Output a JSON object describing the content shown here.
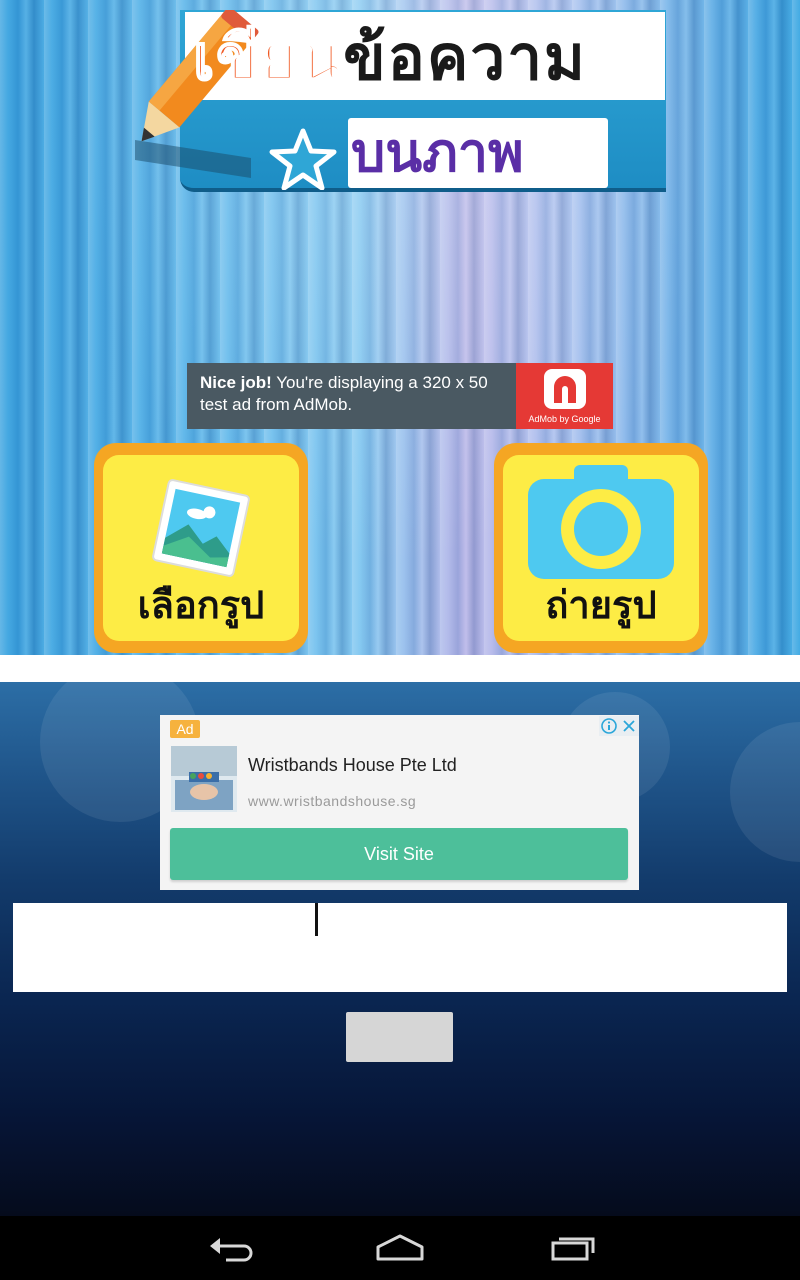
{
  "app": {
    "logo": {
      "line1_red": "เขียน",
      "line1_dark": "ข้อความ",
      "line2": "บนภาพ"
    },
    "buttons": {
      "choose_photo": "เลือกรูป",
      "take_photo": "ถ่ายรูป"
    },
    "submit_label": ""
  },
  "test_ad": {
    "bold": "Nice job!",
    "text": " You're displaying a 320 x 50 test ad from AdMob.",
    "logo_caption": "AdMob by Google"
  },
  "native_ad": {
    "badge": "Ad",
    "title": "Wristbands House Pte Ltd",
    "url": "www.wristbandshouse.sg",
    "cta": "Visit Site"
  },
  "text_input": {
    "value": ""
  },
  "icons": {
    "nav_back": "back-icon",
    "nav_home": "home-icon",
    "nav_recents": "recents-icon"
  },
  "colors": {
    "button_yellow": "#fdec45",
    "button_orange": "#f5a623",
    "cta_green": "#4dbf9a",
    "admob_red": "#e53935"
  }
}
